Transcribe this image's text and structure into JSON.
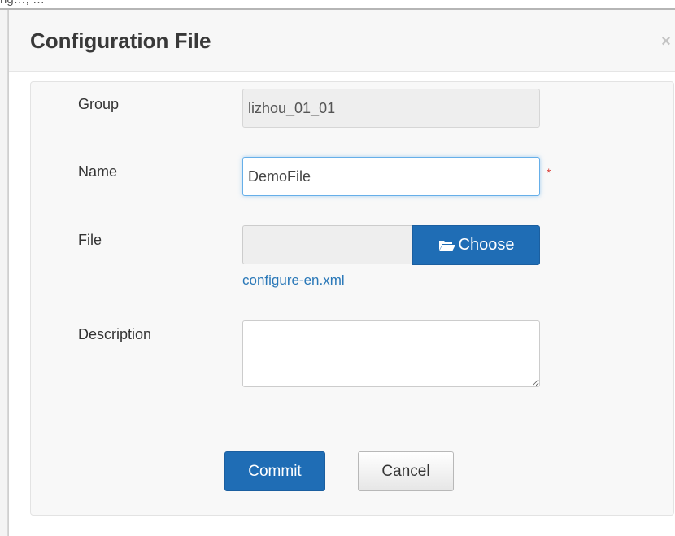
{
  "background_fragment": "ng…, …",
  "dialog": {
    "title": "Configuration File",
    "close_symbol": "×",
    "close_icon": "close-icon"
  },
  "form": {
    "group": {
      "label": "Group",
      "value": "lizhou_01_01",
      "readonly": true
    },
    "name": {
      "label": "Name",
      "value": "DemoFile",
      "required_marker": "*"
    },
    "file": {
      "label": "File",
      "choose_label": "Choose",
      "choose_icon": "folder-open-icon",
      "selected_file": "configure-en.xml"
    },
    "description": {
      "label": "Description",
      "value": ""
    }
  },
  "actions": {
    "commit_label": "Commit",
    "cancel_label": "Cancel"
  },
  "colors": {
    "primary": "#1f6db5",
    "link": "#2a78b8",
    "required": "#d9413a",
    "focus": "#66afe9"
  }
}
